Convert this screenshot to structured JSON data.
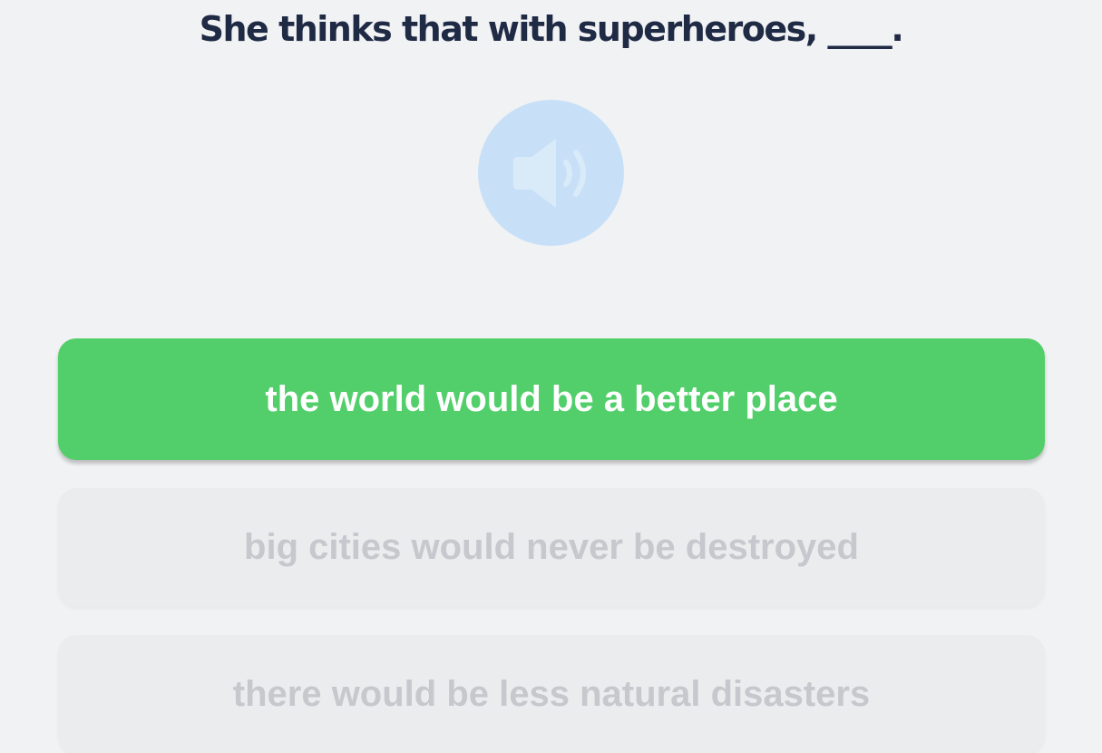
{
  "question": {
    "text": "She thinks that with superheroes, ____."
  },
  "audio": {
    "icon": "speaker-icon",
    "color": "#c8e0f7"
  },
  "options": [
    {
      "label": "the world would be a better place",
      "state": "selected",
      "color": "#52cf6a"
    },
    {
      "label": "big cities would never be destroyed",
      "state": "disabled"
    },
    {
      "label": "there would be less natural disasters",
      "state": "disabled"
    }
  ]
}
